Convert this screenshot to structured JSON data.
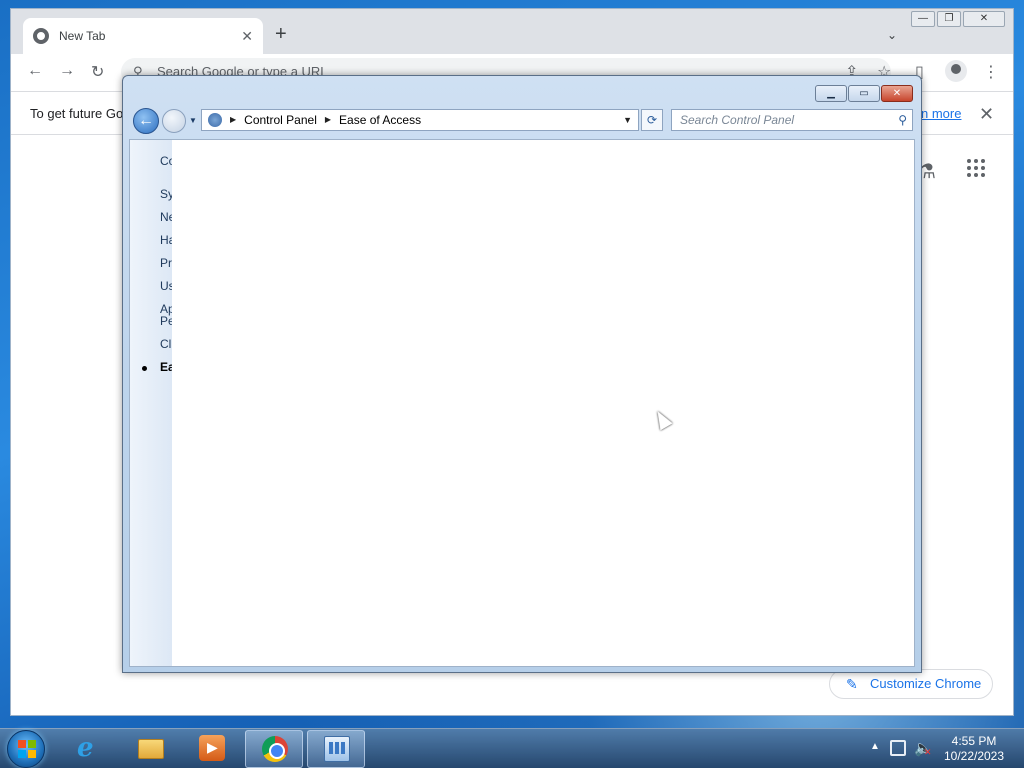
{
  "chrome": {
    "tab_title": "New Tab",
    "tab_close": "✕",
    "new_tab": "+",
    "tab_search": "⌄",
    "omnibox_placeholder": "Search Google or type a URL",
    "infobar_text": "To get future Go",
    "infobar_link": "n more",
    "infobar_close": "✕",
    "customize_label": "Customize Chrome",
    "win_minimize": "—",
    "win_maximize": "❐",
    "win_close": "✕"
  },
  "control_panel": {
    "breadcrumb": [
      "Control Panel",
      "Ease of Access"
    ],
    "search_placeholder": "Search Control Panel",
    "sidebar_items": [
      "Co",
      "Sy",
      "Ne",
      "Ha",
      "Pr",
      "Us",
      "Ap",
      "Pe",
      "Cl",
      "Ea"
    ],
    "btn_min": "▁",
    "btn_max": "▭",
    "btn_close": "✕"
  },
  "taskbar": {
    "time": "4:55 PM",
    "date": "10/22/2023",
    "tray_arrow": "▲",
    "ie_letter": "e"
  },
  "colors": {
    "accent": "#1a73e8",
    "desktop": "#1a6fc4"
  }
}
